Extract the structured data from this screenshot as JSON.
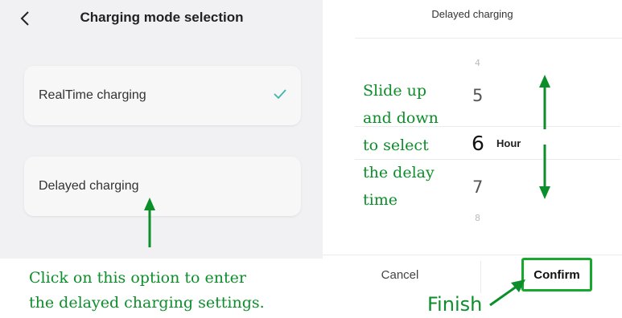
{
  "left": {
    "title": "Charging mode selection",
    "options": [
      {
        "label": "RealTime charging",
        "selected": true
      },
      {
        "label": "Delayed charging",
        "selected": false
      }
    ],
    "annotation": [
      "Click on this option to enter",
      "the delayed charging settings."
    ]
  },
  "right": {
    "title": "Delayed charging",
    "picker": {
      "values": [
        "4",
        "5",
        "6",
        "7",
        "8"
      ],
      "selected": "6",
      "unit": "Hour"
    },
    "annotation": [
      "Slide up",
      "and down",
      "to select",
      "the delay",
      "time"
    ],
    "cancel_label": "Cancel",
    "confirm_label": "Confirm",
    "finish_label": "Finish"
  },
  "colors": {
    "annotation_green": "#0c8e2a",
    "check_teal": "#3cb6a8",
    "confirm_border": "#17a82e"
  }
}
